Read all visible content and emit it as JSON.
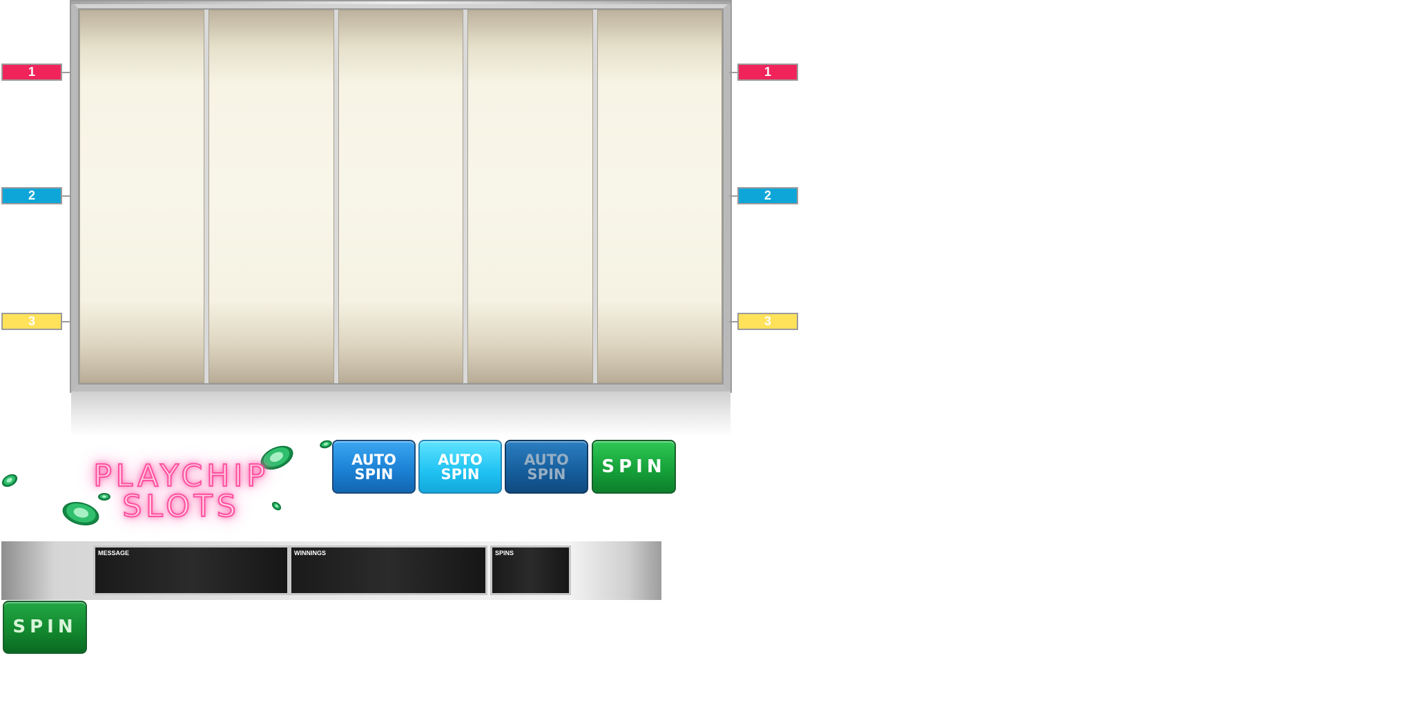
{
  "paylines": {
    "left": [
      {
        "label": "1",
        "color": "#f0245a"
      },
      {
        "label": "2",
        "color": "#0ea6d8"
      },
      {
        "label": "3",
        "color": "#ffe15a"
      }
    ],
    "right": [
      {
        "label": "1",
        "color": "#f0245a"
      },
      {
        "label": "2",
        "color": "#0ea6d8"
      },
      {
        "label": "3",
        "color": "#ffe15a"
      }
    ]
  },
  "logo": {
    "line1": "PLAYCHIP",
    "line2": "SLOTS",
    "neon_color": "#ff4fa0",
    "chip_color": "#2fbf6d"
  },
  "buttons": {
    "auto_spin_normal": {
      "line1": "AUTO",
      "line2": "SPIN"
    },
    "auto_spin_hover": {
      "line1": "AUTO",
      "line2": "SPIN"
    },
    "auto_spin_disabled": {
      "line1": "AUTO",
      "line2": "SPIN"
    },
    "spin_top": "SPIN",
    "spin_bottom": "SPIN"
  },
  "info_panels": {
    "message": {
      "label": "MESSAGE",
      "value": ""
    },
    "winnings": {
      "label": "WINNINGS",
      "value": ""
    },
    "spins": {
      "label": "SPINS",
      "value": ""
    }
  },
  "colors": {
    "reel_bg": "#f8f6e9",
    "frame": "#b9b9b9",
    "spin_green": "#16a23a",
    "auto_blue": "#1a7fd2"
  }
}
